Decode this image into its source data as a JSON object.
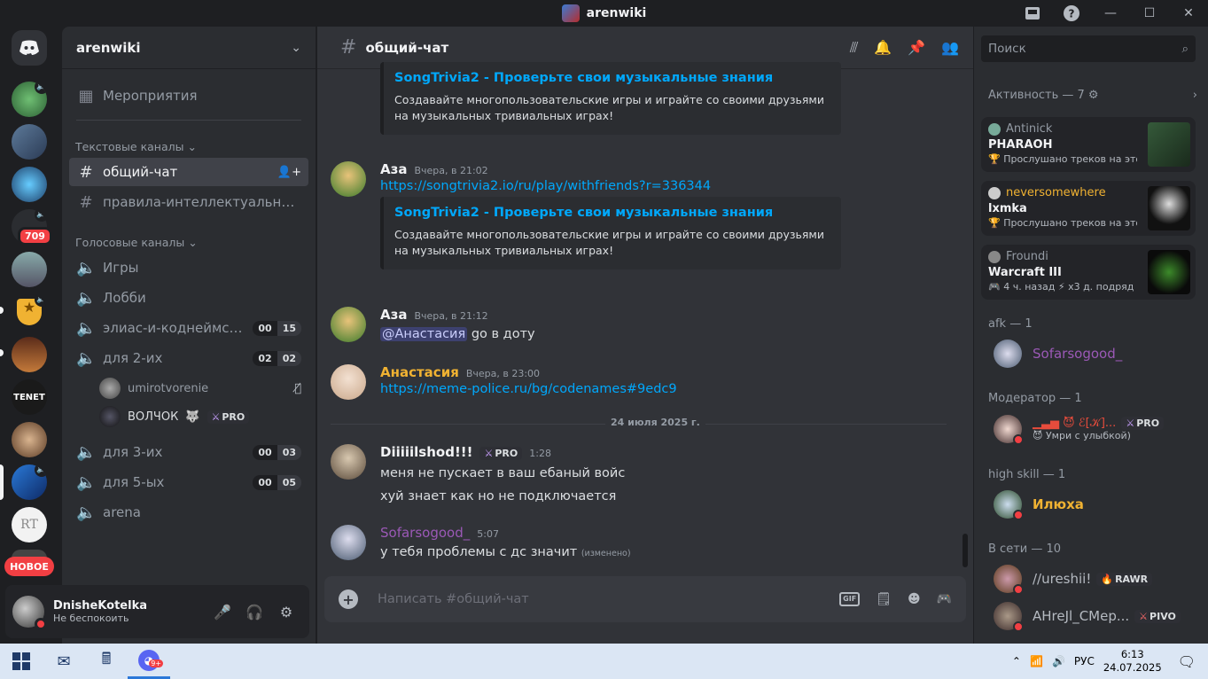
{
  "window": {
    "title": "arenwiki"
  },
  "rail": {
    "new_badge": "НОВОЕ",
    "mention_count": "709",
    "server_text": "TENET",
    "server_text2": "RT"
  },
  "sidebar": {
    "guild_name": "arenwiki",
    "events": "Мероприятия",
    "text_category": "Текстовые каналы",
    "text_channels": [
      "общий-чат",
      "правила-интеллектуальных-игр"
    ],
    "voice_category": "Голосовые каналы",
    "voice_channels": [
      {
        "name": "Игры"
      },
      {
        "name": "Лобби"
      },
      {
        "name": "элиас-и-коднеймс онлайн",
        "c1": "00",
        "c2": "15"
      },
      {
        "name": "для 2-их",
        "c1": "02",
        "c2": "02"
      },
      {
        "name": "для 3-их",
        "c1": "00",
        "c2": "03"
      },
      {
        "name": "для 5-ых",
        "c1": "00",
        "c2": "05"
      },
      {
        "name": "arena"
      }
    ],
    "voice_users": [
      {
        "name": "umirotvorenie"
      },
      {
        "name": "ВОЛЧОК",
        "tag": "PRO"
      }
    ]
  },
  "user_panel": {
    "name": "DnisheKotelka",
    "status": "Не беспокоить"
  },
  "chat": {
    "channel": "общий-чат",
    "search_placeholder": "Поиск",
    "messages": [
      {
        "embed_title": "SongTrivia2 - Проверьте свои музыкальные знания",
        "embed_desc": "Создавайте многопользовательские игры и играйте со своими друзьями на музыкальных тривиальных играх!"
      },
      {
        "author": "Аза",
        "time": "Вчера, в 21:02",
        "link": "https://songtrivia2.io/ru/play/withfriends?r=336344",
        "embed_title": "SongTrivia2 - Проверьте свои музыкальные знания",
        "embed_desc": "Создавайте многопользовательские игры и играйте со своими друзьями на музыкальных тривиальных играх!"
      },
      {
        "author": "Аза",
        "time": "Вчера, в 21:12",
        "mention": "@Анастасия",
        "text": " go в доту"
      },
      {
        "author": "Анастасия",
        "time": "Вчера, в 23:00",
        "link": "https://meme-police.ru/bg/codenames#9edc9"
      },
      {
        "author": "Diiiiilshod!!!",
        "tag": "PRO",
        "time": "1:28",
        "lines": [
          "меня не пускает в ваш ебаный войс",
          "хуй знает как но не подключается"
        ]
      },
      {
        "author": "Sofarsogood_",
        "time": "5:07",
        "text": "у тебя проблемы с дс значит",
        "edited": "(изменено)"
      }
    ],
    "date_divider": "24 июля 2025 г.",
    "composer_placeholder": "Написать #общий-чат"
  },
  "members": {
    "activity_header": "Активность — 7",
    "activities": [
      {
        "user": "Antinick",
        "title": "PHARAOH",
        "sub": "Прослушано треков на этой неделе"
      },
      {
        "user": "neversomewhere",
        "title": "lxmka",
        "sub": "Прослушано треков на этой неделе"
      },
      {
        "user": "Froundi",
        "title": "Warcraft III",
        "sub": "4 ч. назад",
        "sub2": "х3 д. подряд"
      }
    ],
    "groups": [
      {
        "label": "afk — 1",
        "members": [
          {
            "name": "Sofarsogood_"
          }
        ]
      },
      {
        "label": "Модератор — 1",
        "members": [
          {
            "name": "▁▃▅ 😈 ℰ[𝒦]...",
            "tag": "PRO",
            "sub": "😈 Умри с улыбкой)"
          }
        ]
      },
      {
        "label": "high skill — 1",
        "members": [
          {
            "name": "Илюха"
          }
        ]
      },
      {
        "label": "В сети — 10",
        "members": [
          {
            "name": "//ureshii!",
            "tag": "RAWR"
          },
          {
            "name": "AHreJl_CMep...",
            "tag": "PIVO"
          }
        ]
      }
    ]
  },
  "taskbar": {
    "lang": "РУС",
    "time": "6:13",
    "date": "24.07.2025",
    "chat_badge": "9+"
  },
  "colors": {
    "accent": "#5865f2",
    "link": "#00a8fc",
    "dnd": "#f23f43",
    "gold": "#f0b232",
    "purple": "#9b59b6"
  }
}
